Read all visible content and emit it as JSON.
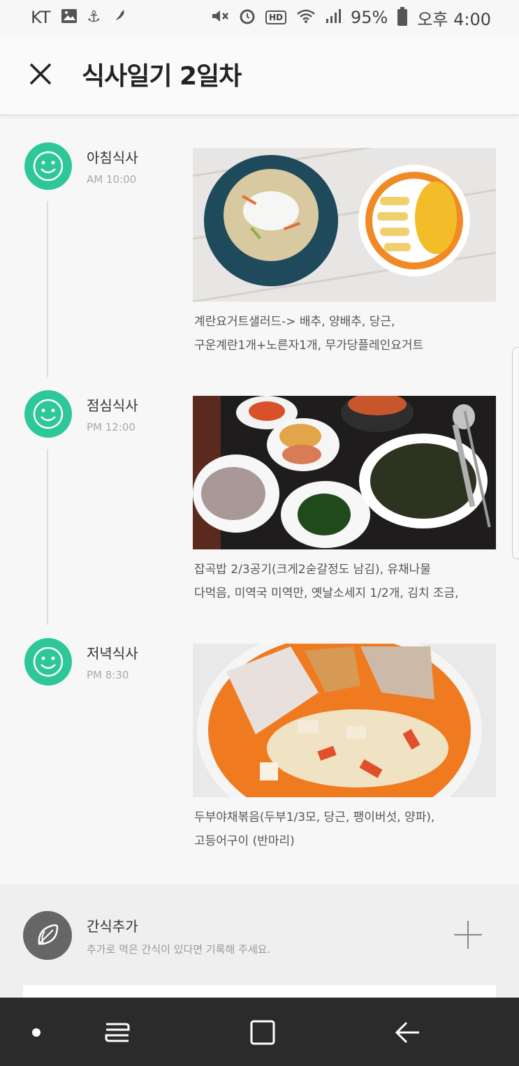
{
  "status_bar": {
    "carrier": "KT",
    "battery": "95%",
    "time": "오후 4:00",
    "left_icons": [
      "image-icon",
      "anchor-icon",
      "feather-icon"
    ],
    "right_icons": [
      "mute-icon",
      "alarm-icon",
      "hd-icon",
      "wifi-icon",
      "signal-icon",
      "battery-icon"
    ],
    "hd_label": "HD"
  },
  "header": {
    "title": "식사일기 2일차",
    "close_icon": "close-icon"
  },
  "meals": [
    {
      "name": "아침식사",
      "time": "AM 10:00",
      "icon": "smile-icon",
      "description": [
        "계란요거트샐러드-> 배추, 양배추, 당근,",
        "구운계란1개+노른자1개, 무가당플레인요거트"
      ]
    },
    {
      "name": "점심식사",
      "time": "PM 12:00",
      "icon": "smile-icon",
      "description": [
        "잡곡밥 2/3공기(크게2숟갈정도 남김), 유채나물",
        "다먹음, 미역국 미역만, 옛날소세지 1/2개, 김치 조금,"
      ]
    },
    {
      "name": "저녁식사",
      "time": "PM 8:30",
      "icon": "smile-icon",
      "description": [
        "두부야채볶음(두부1/3모, 당근, 팽이버섯, 양파),",
        "고등어구이 (반마리)"
      ]
    }
  ],
  "snack": {
    "title": "간식추가",
    "subtitle": "추가로 먹은 간식이 있다면 기록해 주세요.",
    "icon": "leaf-icon",
    "add_icon": "plus-icon"
  },
  "nav_bar": {
    "icons": [
      "dot-icon",
      "recent-apps-icon",
      "home-icon",
      "back-icon"
    ]
  },
  "colors": {
    "accent": "#2ec799",
    "snack_icon": "#666666",
    "nav_bar": "#2b2b2b"
  }
}
